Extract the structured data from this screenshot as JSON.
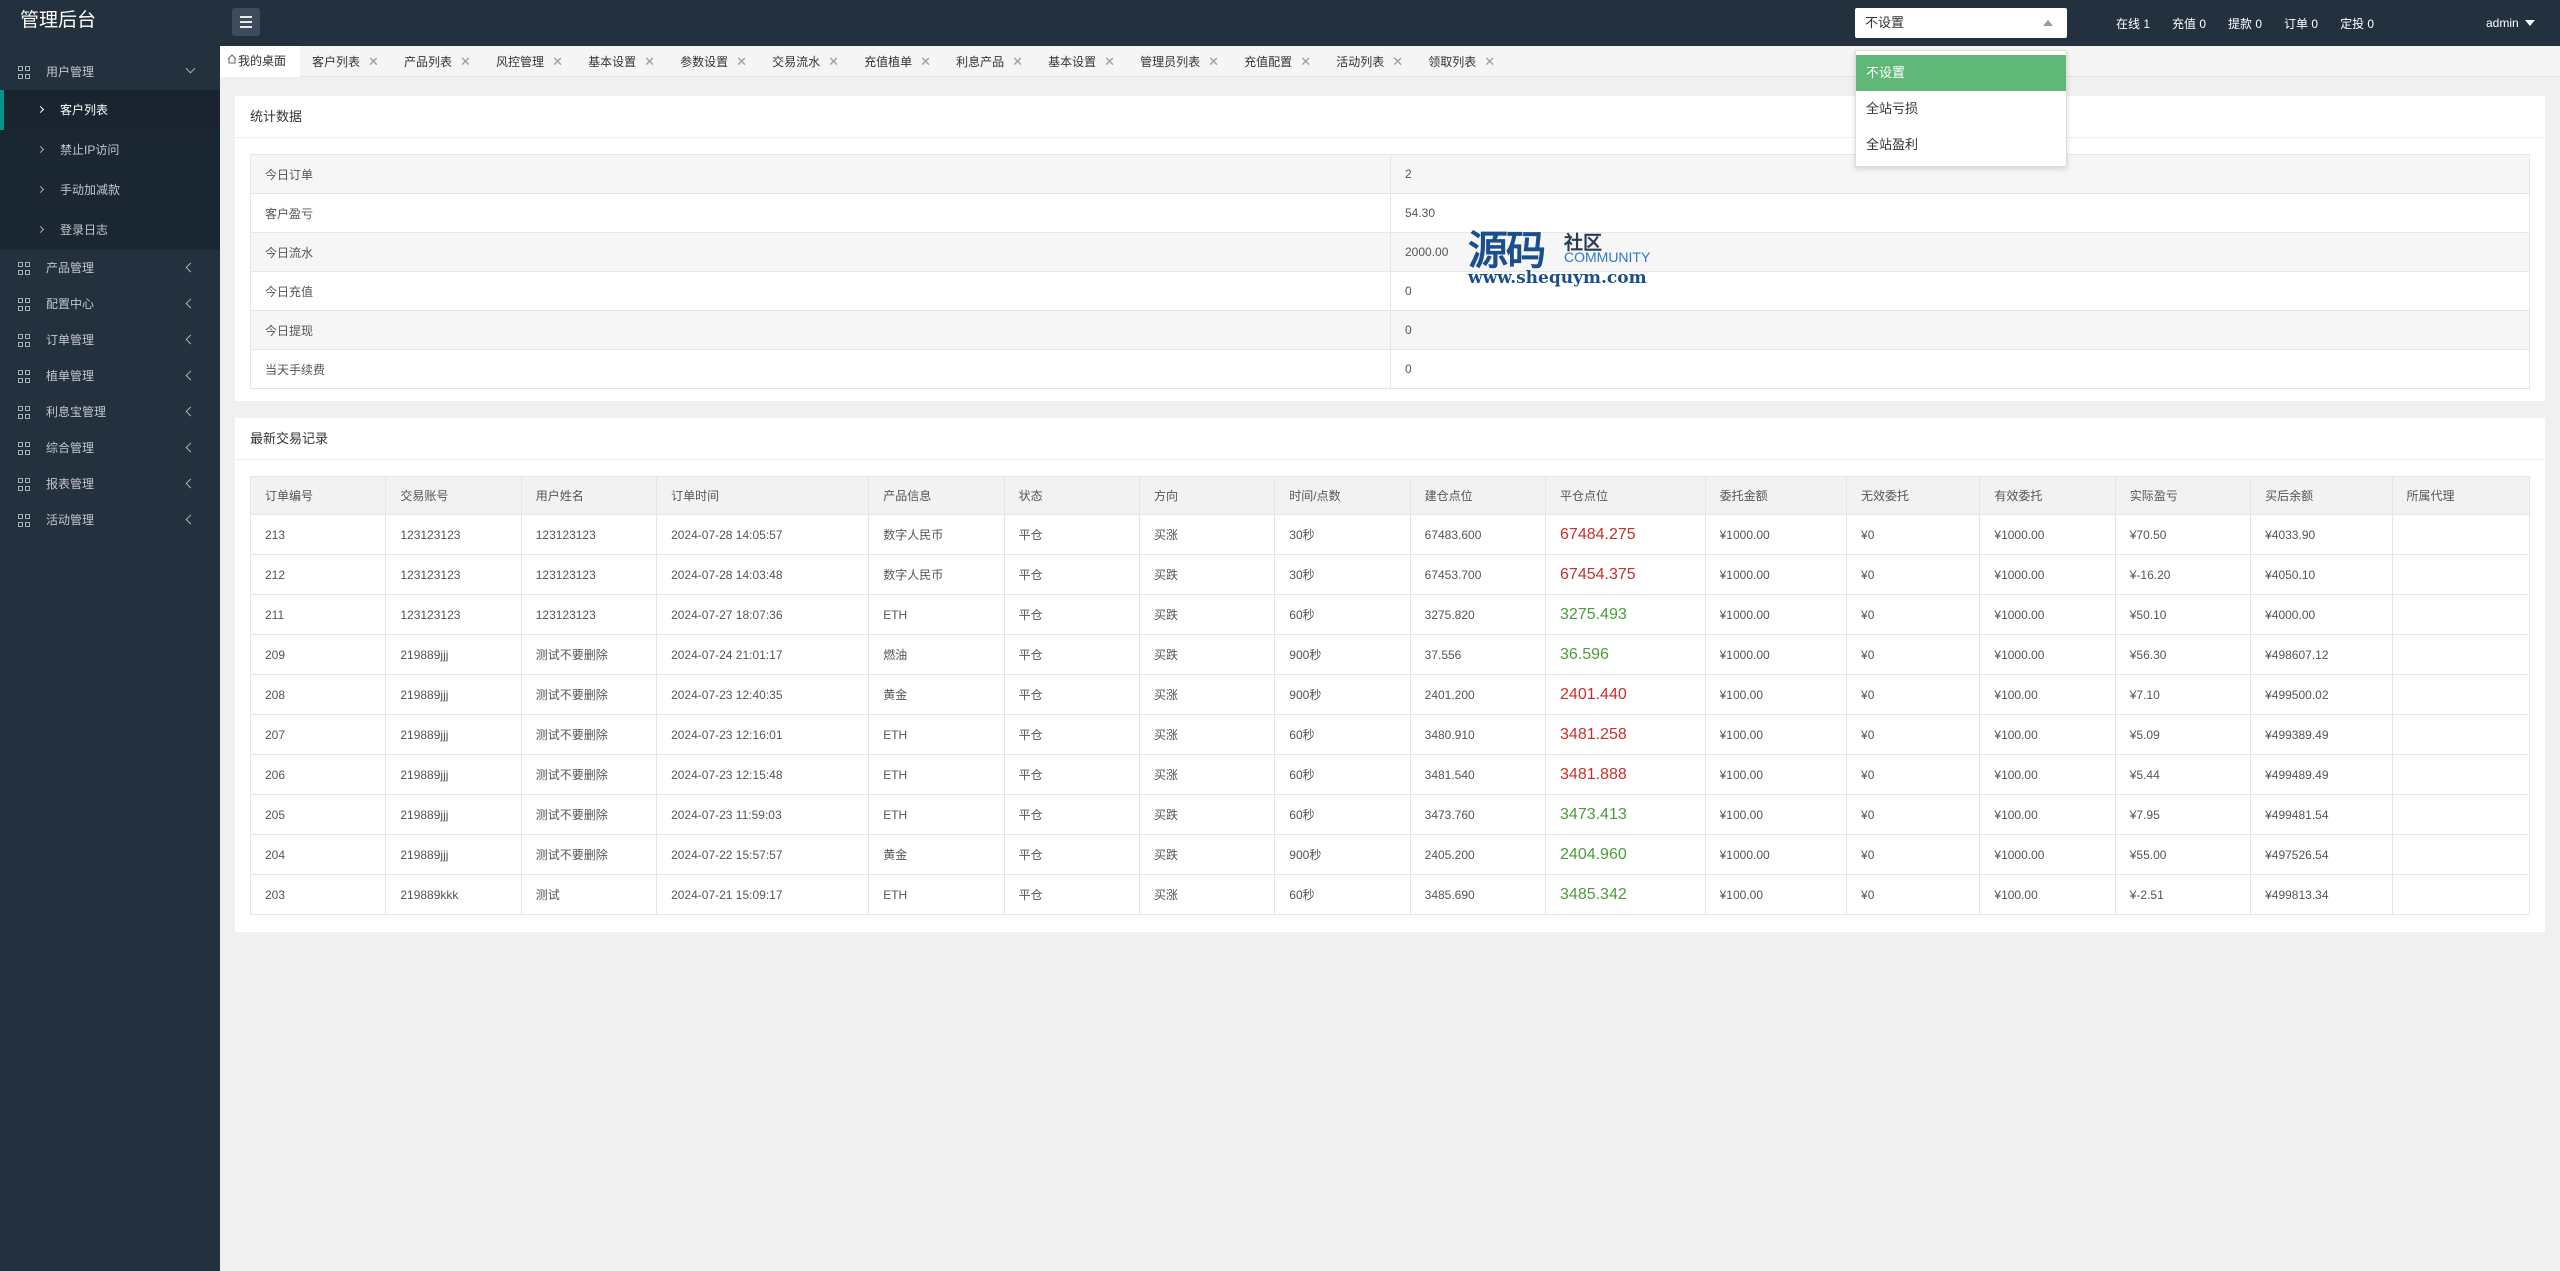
{
  "app": {
    "title": "管理后台"
  },
  "top": {
    "select_value": "不设置",
    "stats": [
      "在线 1",
      "充值 0",
      "提款 0",
      "订单 0",
      "定投 0"
    ],
    "user": "admin"
  },
  "dropdown": {
    "options": [
      "不设置",
      "全站亏损",
      "全站盈利"
    ],
    "selected": "不设置"
  },
  "sidebar": {
    "groups": [
      {
        "label": "用户管理",
        "expanded": true,
        "children": [
          "客户列表",
          "禁止IP访问",
          "手动加减款",
          "登录日志"
        ],
        "active_child": "客户列表"
      },
      {
        "label": "产品管理"
      },
      {
        "label": "配置中心"
      },
      {
        "label": "订单管理"
      },
      {
        "label": "植单管理"
      },
      {
        "label": "利息宝管理"
      },
      {
        "label": "综合管理"
      },
      {
        "label": "报表管理"
      },
      {
        "label": "活动管理"
      }
    ]
  },
  "tabs": [
    "我的桌面",
    "客户列表",
    "产品列表",
    "风控管理",
    "基本设置",
    "参数设置",
    "交易流水",
    "充值植单",
    "利息产品",
    "基本设置",
    "管理员列表",
    "充值配置",
    "活动列表",
    "领取列表"
  ],
  "stats_panel": {
    "title": "统计数据",
    "rows": [
      {
        "label": "今日订单",
        "value": "2"
      },
      {
        "label": "客户盈亏",
        "value": "54.30"
      },
      {
        "label": "今日流水",
        "value": "2000.00"
      },
      {
        "label": "今日充值",
        "value": "0"
      },
      {
        "label": "今日提现",
        "value": "0"
      },
      {
        "label": "当天手续费",
        "value": "0"
      }
    ]
  },
  "watermark": {
    "cn": "源码",
    "sq": "社区",
    "en": "COMMUNITY",
    "url": "www.shequym.com"
  },
  "trades_panel": {
    "title": "最新交易记录",
    "columns": [
      "订单编号",
      "交易账号",
      "用户姓名",
      "订单时间",
      "产品信息",
      "状态",
      "方向",
      "时间/点数",
      "建仓点位",
      "平仓点位",
      "委托金额",
      "无效委托",
      "有效委托",
      "实际盈亏",
      "买后余额",
      "所属代理"
    ],
    "rows": [
      {
        "id": "213",
        "account": "123123123",
        "name": "123123123",
        "time": "2024-07-28 14:05:57",
        "product": "数字人民币",
        "status": "平仓",
        "dir": "买涨",
        "dur": "30秒",
        "open": "67483.600",
        "close": "67484.275",
        "close_color": "red",
        "amount": "¥1000.00",
        "invalid": "¥0",
        "valid": "¥1000.00",
        "pnl": "¥70.50",
        "balance": "¥4033.90",
        "agent": ""
      },
      {
        "id": "212",
        "account": "123123123",
        "name": "123123123",
        "time": "2024-07-28 14:03:48",
        "product": "数字人民币",
        "status": "平仓",
        "dir": "买跌",
        "dur": "30秒",
        "open": "67453.700",
        "close": "67454.375",
        "close_color": "red",
        "amount": "¥1000.00",
        "invalid": "¥0",
        "valid": "¥1000.00",
        "pnl": "¥-16.20",
        "balance": "¥4050.10",
        "agent": ""
      },
      {
        "id": "211",
        "account": "123123123",
        "name": "123123123",
        "time": "2024-07-27 18:07:36",
        "product": "ETH",
        "status": "平仓",
        "dir": "买跌",
        "dur": "60秒",
        "open": "3275.820",
        "close": "3275.493",
        "close_color": "green",
        "amount": "¥1000.00",
        "invalid": "¥0",
        "valid": "¥1000.00",
        "pnl": "¥50.10",
        "balance": "¥4000.00",
        "agent": ""
      },
      {
        "id": "209",
        "account": "219889jjj",
        "name": "测试不要删除",
        "time": "2024-07-24 21:01:17",
        "product": "燃油",
        "status": "平仓",
        "dir": "买跌",
        "dur": "900秒",
        "open": "37.556",
        "close": "36.596",
        "close_color": "green",
        "amount": "¥1000.00",
        "invalid": "¥0",
        "valid": "¥1000.00",
        "pnl": "¥56.30",
        "balance": "¥498607.12",
        "agent": ""
      },
      {
        "id": "208",
        "account": "219889jjj",
        "name": "测试不要删除",
        "time": "2024-07-23 12:40:35",
        "product": "黄金",
        "status": "平仓",
        "dir": "买涨",
        "dur": "900秒",
        "open": "2401.200",
        "close": "2401.440",
        "close_color": "red",
        "amount": "¥100.00",
        "invalid": "¥0",
        "valid": "¥100.00",
        "pnl": "¥7.10",
        "balance": "¥499500.02",
        "agent": ""
      },
      {
        "id": "207",
        "account": "219889jjj",
        "name": "测试不要删除",
        "time": "2024-07-23 12:16:01",
        "product": "ETH",
        "status": "平仓",
        "dir": "买涨",
        "dur": "60秒",
        "open": "3480.910",
        "close": "3481.258",
        "close_color": "red",
        "amount": "¥100.00",
        "invalid": "¥0",
        "valid": "¥100.00",
        "pnl": "¥5.09",
        "balance": "¥499389.49",
        "agent": ""
      },
      {
        "id": "206",
        "account": "219889jjj",
        "name": "测试不要删除",
        "time": "2024-07-23 12:15:48",
        "product": "ETH",
        "status": "平仓",
        "dir": "买涨",
        "dur": "60秒",
        "open": "3481.540",
        "close": "3481.888",
        "close_color": "red",
        "amount": "¥100.00",
        "invalid": "¥0",
        "valid": "¥100.00",
        "pnl": "¥5.44",
        "balance": "¥499489.49",
        "agent": ""
      },
      {
        "id": "205",
        "account": "219889jjj",
        "name": "测试不要删除",
        "time": "2024-07-23 11:59:03",
        "product": "ETH",
        "status": "平仓",
        "dir": "买跌",
        "dur": "60秒",
        "open": "3473.760",
        "close": "3473.413",
        "close_color": "green",
        "amount": "¥100.00",
        "invalid": "¥0",
        "valid": "¥100.00",
        "pnl": "¥7.95",
        "balance": "¥499481.54",
        "agent": ""
      },
      {
        "id": "204",
        "account": "219889jjj",
        "name": "测试不要删除",
        "time": "2024-07-22 15:57:57",
        "product": "黄金",
        "status": "平仓",
        "dir": "买跌",
        "dur": "900秒",
        "open": "2405.200",
        "close": "2404.960",
        "close_color": "green",
        "amount": "¥1000.00",
        "invalid": "¥0",
        "valid": "¥1000.00",
        "pnl": "¥55.00",
        "balance": "¥497526.54",
        "agent": ""
      },
      {
        "id": "203",
        "account": "219889kkk",
        "name": "测试",
        "time": "2024-07-21 15:09:17",
        "product": "ETH",
        "status": "平仓",
        "dir": "买涨",
        "dur": "60秒",
        "open": "3485.690",
        "close": "3485.342",
        "close_color": "green",
        "amount": "¥100.00",
        "invalid": "¥0",
        "valid": "¥100.00",
        "pnl": "¥-2.51",
        "balance": "¥499813.34",
        "agent": ""
      }
    ]
  },
  "colors": {
    "sidebar_bg": "#23303e",
    "accent": "#009688",
    "selected": "#5fb878",
    "up": "#c9302c",
    "down": "#4a9d3b"
  }
}
